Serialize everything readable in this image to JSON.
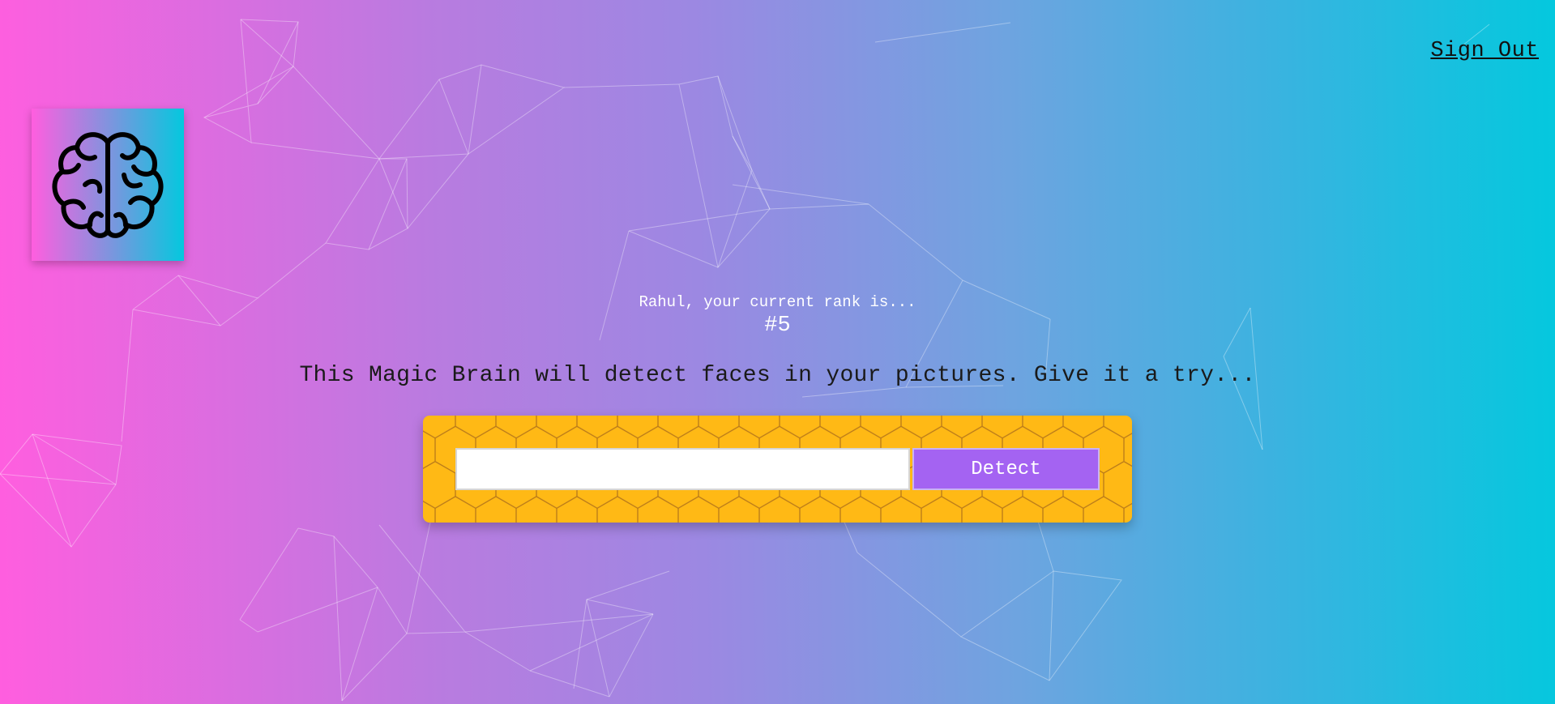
{
  "nav": {
    "signout_label": "Sign Out"
  },
  "logo": {
    "icon": "brain-icon",
    "gradient_start": "#ff5edf",
    "gradient_end": "#04c8de"
  },
  "rank": {
    "message": "Rahul, your current rank is...",
    "value": "#5"
  },
  "intro": {
    "text": "This Magic Brain will detect faces in your pictures. Give it a try..."
  },
  "image_form": {
    "input_value": "",
    "input_placeholder": "",
    "button_label": "Detect",
    "button_color": "#a463f2",
    "panel_color": "#ffb915"
  },
  "colors": {
    "background_start": "#ff5edf",
    "background_end": "#04c8de",
    "text_dark": "#1a1a1a",
    "text_light": "#ffffff"
  }
}
